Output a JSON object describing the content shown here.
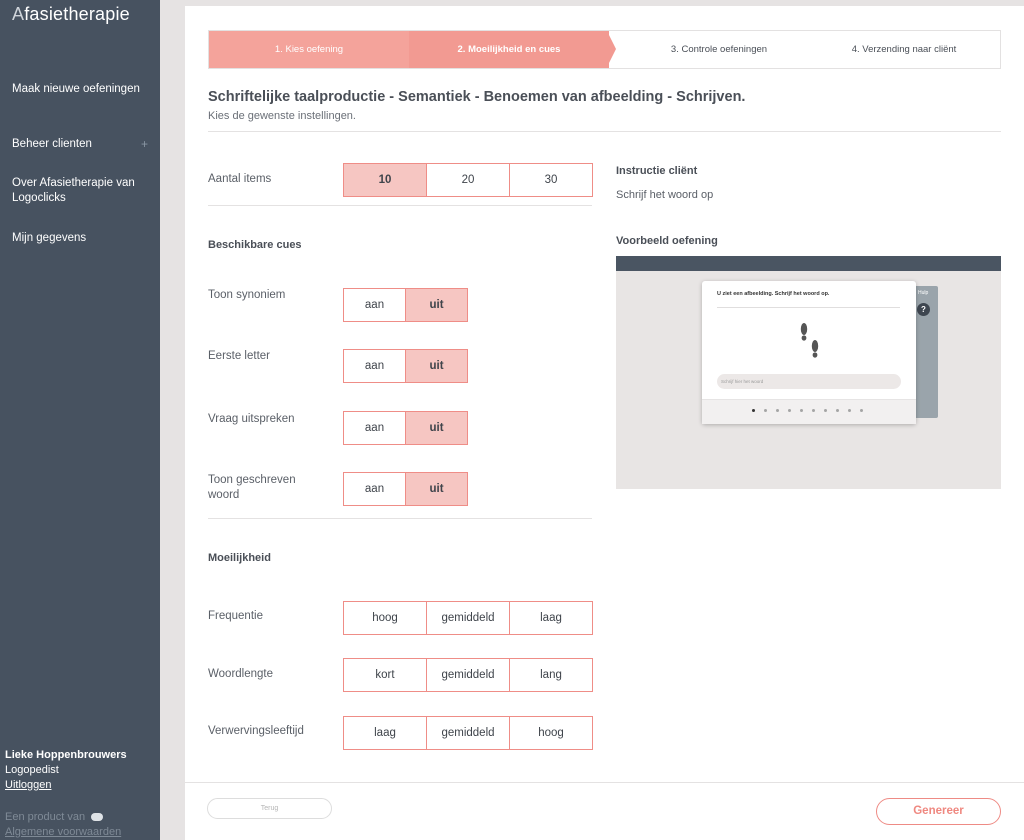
{
  "sidebar": {
    "logo_a": "A",
    "logo_rest": "fasietherapie",
    "items": [
      {
        "label": "Maak nieuwe oefeningen"
      },
      {
        "label": "Beheer clienten",
        "plus": "+"
      },
      {
        "label": "Over Afasietherapie van Logoclicks"
      },
      {
        "label": "Mijn gegevens"
      }
    ],
    "user": {
      "name": "Lieke Hoppenbrouwers",
      "role": "Logopedist",
      "logout": "Uitloggen"
    },
    "product": "Een product van",
    "terms": "Algemene voorwaarden"
  },
  "stepper": {
    "steps": [
      {
        "label": "1. Kies oefening"
      },
      {
        "label": "2. Moeilijkheid en cues"
      },
      {
        "label": "3. Controle oefeningen"
      },
      {
        "label": "4. Verzending naar cliënt"
      }
    ]
  },
  "page": {
    "title": "Schriftelijke taalproductie - Semantiek - Benoemen van afbeelding - Schrijven.",
    "subtitle": "Kies de gewenste instellingen."
  },
  "settings": {
    "aantal": {
      "label": "Aantal items",
      "options": [
        "10",
        "20",
        "30"
      ],
      "selected": "10"
    },
    "cues_title": "Beschikbare cues",
    "cues": [
      {
        "label": "Toon synoniem",
        "on": "aan",
        "off": "uit"
      },
      {
        "label": "Eerste letter",
        "on": "aan",
        "off": "uit"
      },
      {
        "label": "Vraag uitspreken",
        "on": "aan",
        "off": "uit"
      },
      {
        "label": "Toon geschreven woord",
        "on": "aan",
        "off": "uit"
      }
    ],
    "moeilijkheid_title": "Moeilijkheid",
    "difficulty": [
      {
        "label": "Frequentie",
        "options": [
          "hoog",
          "gemiddeld",
          "laag"
        ]
      },
      {
        "label": "Woordlengte",
        "options": [
          "kort",
          "gemiddeld",
          "lang"
        ]
      },
      {
        "label": "Verwervingsleeftijd",
        "options": [
          "laag",
          "gemiddeld",
          "hoog"
        ]
      }
    ]
  },
  "instructie": {
    "title": "Instructie cliënt",
    "text": "Schrijf het woord op"
  },
  "voorbeeld": {
    "title": "Voorbeeld oefening",
    "card_instruction": "U ziet een afbeelding. Schrijf het woord op.",
    "input_placeholder": "Schrijf hier het woord",
    "help_label": "Hulp",
    "help_icon": "?",
    "page_count": 10,
    "active_page": 1
  },
  "footer": {
    "back": "Terug",
    "generate": "Genereer"
  }
}
